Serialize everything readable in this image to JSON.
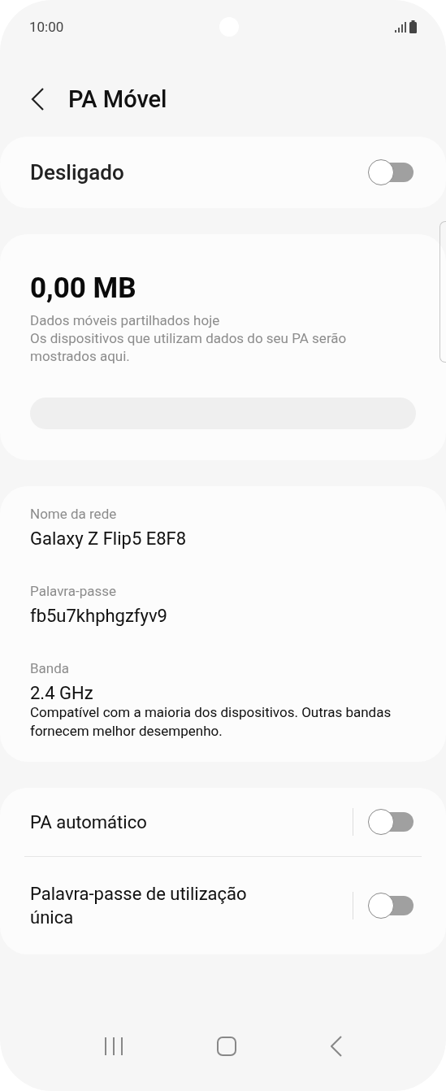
{
  "status_bar": {
    "time": "10:00"
  },
  "header": {
    "title": "PA Móvel"
  },
  "master": {
    "label": "Desligado",
    "on": false
  },
  "usage": {
    "amount": "0,00 MB",
    "description": "Dados móveis partilhados hoje",
    "note": "Os dispositivos que utilizam dados do seu PA serão mostrados aqui."
  },
  "details": [
    {
      "label": "Nome da rede",
      "value": "Galaxy Z Flip5 E8F8"
    },
    {
      "label": "Palavra-passe",
      "value": "fb5u7khphgzfyv9"
    },
    {
      "label": "Banda",
      "value": "2.4 GHz",
      "note": "Compatível com a maioria dos dispositivos. Outras bandas fornecem melhor desempenho."
    }
  ],
  "options": [
    {
      "label": "PA automático",
      "on": false
    },
    {
      "label": "Palavra-passe de utilização única",
      "on": false
    }
  ]
}
